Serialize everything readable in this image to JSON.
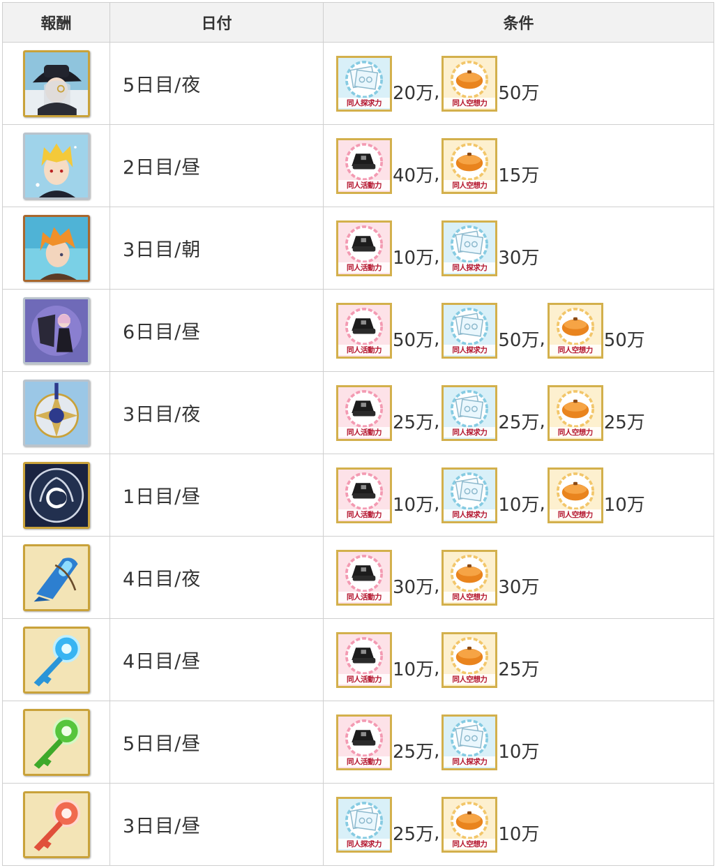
{
  "table": {
    "headers": {
      "reward": "報酬",
      "date": "日付",
      "condition": "条件"
    },
    "material_labels": {
      "activity": "同人活動力",
      "explore": "同人探求力",
      "imagine": "同人空想力"
    },
    "separator": ",",
    "rows": [
      {
        "reward_icon": "servant-portrait-dark-hat-icon",
        "date": "5日目/夜",
        "conditions": [
          {
            "item": "explore",
            "amount": "20万"
          },
          {
            "item": "imagine",
            "amount": "50万"
          }
        ]
      },
      {
        "reward_icon": "servant-portrait-blonde-icon",
        "date": "2日目/昼",
        "conditions": [
          {
            "item": "activity",
            "amount": "40万"
          },
          {
            "item": "imagine",
            "amount": "15万"
          }
        ]
      },
      {
        "reward_icon": "servant-portrait-orange-hair-icon",
        "date": "3日目/朝",
        "conditions": [
          {
            "item": "activity",
            "amount": "10万"
          },
          {
            "item": "explore",
            "amount": "30万"
          }
        ]
      },
      {
        "reward_icon": "craft-essence-shielder-icon",
        "date": "6日目/昼",
        "conditions": [
          {
            "item": "activity",
            "amount": "50万"
          },
          {
            "item": "explore",
            "amount": "50万"
          },
          {
            "item": "imagine",
            "amount": "50万"
          }
        ]
      },
      {
        "reward_icon": "grail-medal-emblem-icon",
        "date": "3日目/夜",
        "conditions": [
          {
            "item": "activity",
            "amount": "25万"
          },
          {
            "item": "explore",
            "amount": "25万"
          },
          {
            "item": "imagine",
            "amount": "25万"
          }
        ]
      },
      {
        "reward_icon": "chaldea-laurel-seal-icon",
        "date": "1日目/昼",
        "conditions": [
          {
            "item": "activity",
            "amount": "10万"
          },
          {
            "item": "explore",
            "amount": "10万"
          },
          {
            "item": "imagine",
            "amount": "10万"
          }
        ]
      },
      {
        "reward_icon": "blue-tool-wedge-icon",
        "date": "4日目/夜",
        "conditions": [
          {
            "item": "activity",
            "amount": "30万"
          },
          {
            "item": "imagine",
            "amount": "30万"
          }
        ]
      },
      {
        "reward_icon": "blue-key-icon",
        "date": "4日目/昼",
        "conditions": [
          {
            "item": "activity",
            "amount": "10万"
          },
          {
            "item": "imagine",
            "amount": "25万"
          }
        ]
      },
      {
        "reward_icon": "green-key-icon",
        "date": "5日目/昼",
        "conditions": [
          {
            "item": "activity",
            "amount": "25万"
          },
          {
            "item": "explore",
            "amount": "10万"
          }
        ]
      },
      {
        "reward_icon": "red-key-icon",
        "date": "3日目/昼",
        "conditions": [
          {
            "item": "explore",
            "amount": "25万"
          },
          {
            "item": "imagine",
            "amount": "10万"
          }
        ]
      }
    ]
  }
}
